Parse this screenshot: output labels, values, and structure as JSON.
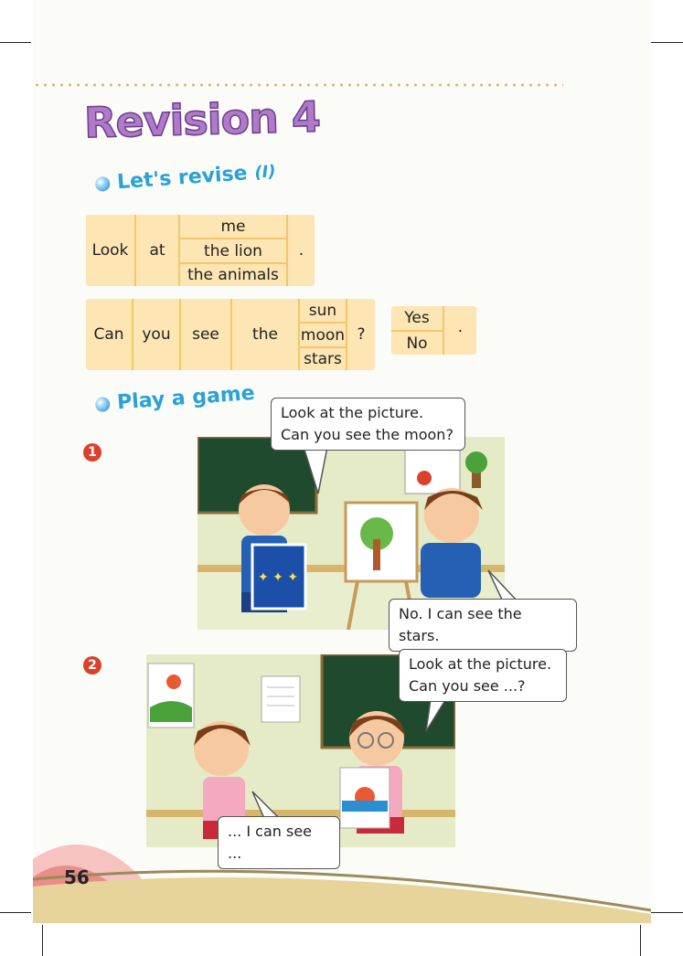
{
  "page": {
    "number": "56"
  },
  "title": {
    "text": "Revision 4"
  },
  "section1": {
    "title": "Let's revise",
    "roman": "(I)"
  },
  "table1": {
    "col1": "Look",
    "col2": "at",
    "options": [
      "me",
      "the lion",
      "the animals"
    ],
    "end": "."
  },
  "table2": {
    "words": [
      "Can",
      "you",
      "see",
      "the"
    ],
    "options": [
      "sun",
      "moon",
      "stars"
    ],
    "end": "?"
  },
  "answer_table": {
    "options": [
      "Yes",
      "No"
    ],
    "end": "."
  },
  "section2": {
    "title": "Play a game"
  },
  "game1": {
    "number": "1",
    "bubble_top": [
      "Look at the picture.",
      "Can you see the moon?"
    ],
    "bubble_bottom": "No. I can see the stars."
  },
  "game2": {
    "number": "2",
    "bubble_top": [
      "Look at the picture.",
      "Can you see ...?"
    ],
    "bubble_bottom": "... I can see ..."
  },
  "colors": {
    "accent_blue": "#2aa1d8",
    "table_fill": "#fde6b3",
    "table_line": "#f5c66a",
    "number_red": "#d9412d"
  }
}
